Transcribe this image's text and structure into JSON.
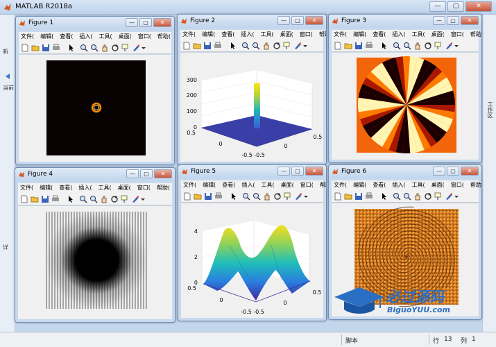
{
  "app": {
    "title": "MATLAB R2018a"
  },
  "left_strip": {
    "label_a": "新",
    "label_b": "当前",
    "label_c": "详"
  },
  "right_strip": {
    "label": "工作区"
  },
  "status": {
    "mode": "脚本",
    "row_label": "行",
    "row_value": "13",
    "col_label": "列",
    "col_value": "1"
  },
  "window_controls": {
    "minimize": "—",
    "restore": "▢",
    "close": "✕"
  },
  "figures": [
    {
      "title": "Figure 1"
    },
    {
      "title": "Figure 2"
    },
    {
      "title": "Figure 3"
    },
    {
      "title": "Figure 4"
    },
    {
      "title": "Figure 5"
    },
    {
      "title": "Figure 6"
    }
  ],
  "menu": [
    "文件(",
    "编辑(",
    "查看(",
    "插入(",
    "工具(",
    "桌面(",
    "窗口(",
    "帮助("
  ],
  "figure2_axes": {
    "z_ticks": [
      "300",
      "200",
      "100",
      "0"
    ],
    "x_ticks": [
      "0.5",
      "0",
      "-0.5"
    ],
    "y_ticks": [
      "-0.5",
      "0",
      "0.5"
    ]
  },
  "figure5_axes": {
    "z_ticks": [
      "4",
      "2",
      "0"
    ],
    "x_ticks": [
      "0.5",
      "0",
      "-0.5"
    ],
    "y_ticks": [
      "-0.5",
      "0",
      "0.5"
    ]
  },
  "watermark": {
    "brand": "必过源码",
    "site": "BiguoYUU.com"
  },
  "colors": {
    "figure_bg": "#c7d9ee",
    "titlebar": "#dfeaf7",
    "accent": "#2b6fc4"
  }
}
